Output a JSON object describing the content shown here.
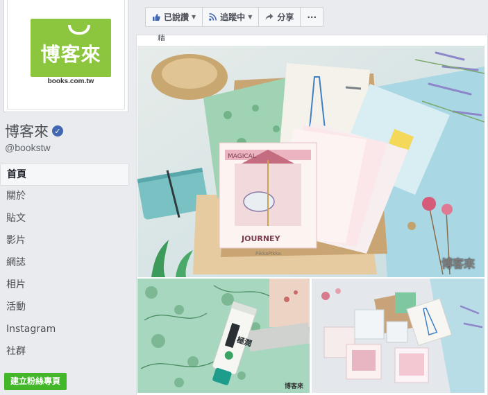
{
  "sidebar": {
    "logo_text": "博客來",
    "logo_url": "books.com.tw",
    "page_name": "博客來",
    "handle": "@bookstw",
    "nav": [
      "首頁",
      "關於",
      "貼文",
      "影片",
      "網誌",
      "相片",
      "活動",
      "Instagram",
      "社群"
    ],
    "create_page_label": "建立粉絲專頁"
  },
  "actions": {
    "liked": "已說讚",
    "following": "追蹤中",
    "share": "分享",
    "more": "···"
  },
  "post": {
    "caption": "精",
    "photo_main_text": {
      "card_title_left": "MAGICAL",
      "card_title_right": "JOURNEY",
      "brand": "PikkaPikka",
      "watermark": "博客來"
    },
    "photo_bl_text": {
      "product": "極潤",
      "watermark": "博客來"
    }
  },
  "colors": {
    "fb_blue": "#4267b2",
    "brand_green": "#8cc63f",
    "create_green": "#42b72a"
  }
}
